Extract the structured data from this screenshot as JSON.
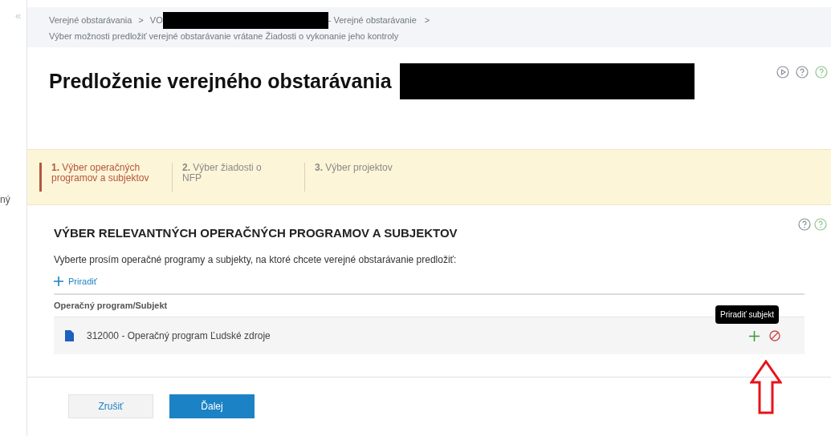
{
  "sidebar": {
    "collapse": "«",
    "cut_text": "ný"
  },
  "breadcrumb": {
    "items": [
      {
        "text": "Verejné obstarávania"
      },
      {
        "text": "VO",
        "redacted_after": true
      },
      {
        "text": "- Verejné obstarávanie"
      }
    ],
    "separator": ">",
    "current": "Výber možnosti predložiť verejné obstarávanie vrátane Žiadosti o vykonanie jeho kontroly"
  },
  "header": {
    "title": "Predloženie verejného obstarávania",
    "redacted_after": true
  },
  "steps": [
    {
      "number": "1.",
      "label": "Výber operačných programov a subjektov",
      "selected": true
    },
    {
      "number": "2.",
      "label": "Výber žiadosti o NFP",
      "selected": false
    },
    {
      "number": "3.",
      "label": "Výber projektov",
      "selected": false
    }
  ],
  "section": {
    "title": "VÝBER RELEVANTNÝCH OPERAČNÝCH PROGRAMOV A SUBJEKTOV",
    "instruction": "Vyberte prosím operačné programy a subjekty, na ktoré chcete verejné obstarávanie predložiť:",
    "add_label": "Priradiť"
  },
  "table": {
    "columns": [
      "Operačný program/Subjekt"
    ],
    "rows": [
      {
        "name": "312000 - Operačný program Ľudské zdroje"
      }
    ]
  },
  "tooltip": "Priradiť subjekt",
  "buttons": [
    {
      "label": "Zrušiť",
      "kind": "secondary"
    },
    {
      "label": "Ďalej",
      "kind": "primary"
    }
  ]
}
